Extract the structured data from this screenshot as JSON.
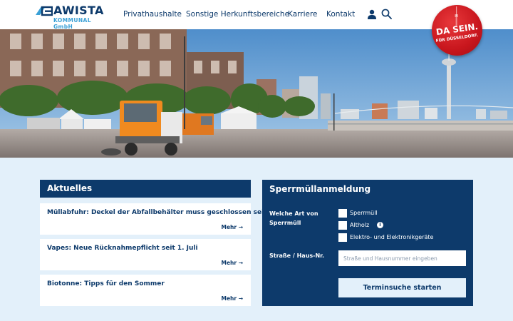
{
  "brand": {
    "name": "AWISTA",
    "sub": "KOMMUNAL GmbH",
    "colors": {
      "primary": "#0d3a6b",
      "accent": "#3aa0d6",
      "badge": "#c8161d",
      "page_bg": "#e3f0fa"
    }
  },
  "nav": {
    "items": [
      {
        "label": "Privathaushalte"
      },
      {
        "label": "Sonstige Herkunftsbereiche"
      },
      {
        "label": "Karriere"
      },
      {
        "label": "Kontakt"
      }
    ],
    "icons": [
      "user-icon",
      "search-icon"
    ]
  },
  "badge": {
    "main": "DA SEIN.",
    "sub": "FÜR DÜSSELDORF."
  },
  "news": {
    "title": "Aktuelles",
    "more_label": "Mehr",
    "items": [
      {
        "title": "Müllabfuhr: Deckel der Abfallbehälter muss geschlossen sein"
      },
      {
        "title": "Vapes: Neue Rücknahmepflicht seit 1. Juli"
      },
      {
        "title": "Biotonne: Tipps für den Sommer"
      }
    ]
  },
  "form": {
    "title": "Sperrmüllanmeldung",
    "question": "Welche Art von Sperrmüll",
    "options": [
      {
        "label": "Sperrmüll",
        "checked": false
      },
      {
        "label": "Altholz",
        "checked": false,
        "info": "i"
      },
      {
        "label": "Elektro- und Elektronikgeräte",
        "checked": false
      }
    ],
    "address_label": "Straße / Haus-Nr.",
    "address_value": "",
    "address_placeholder": "Straße und Hausnummer eingeben",
    "submit_label": "Terminsuche starten"
  }
}
